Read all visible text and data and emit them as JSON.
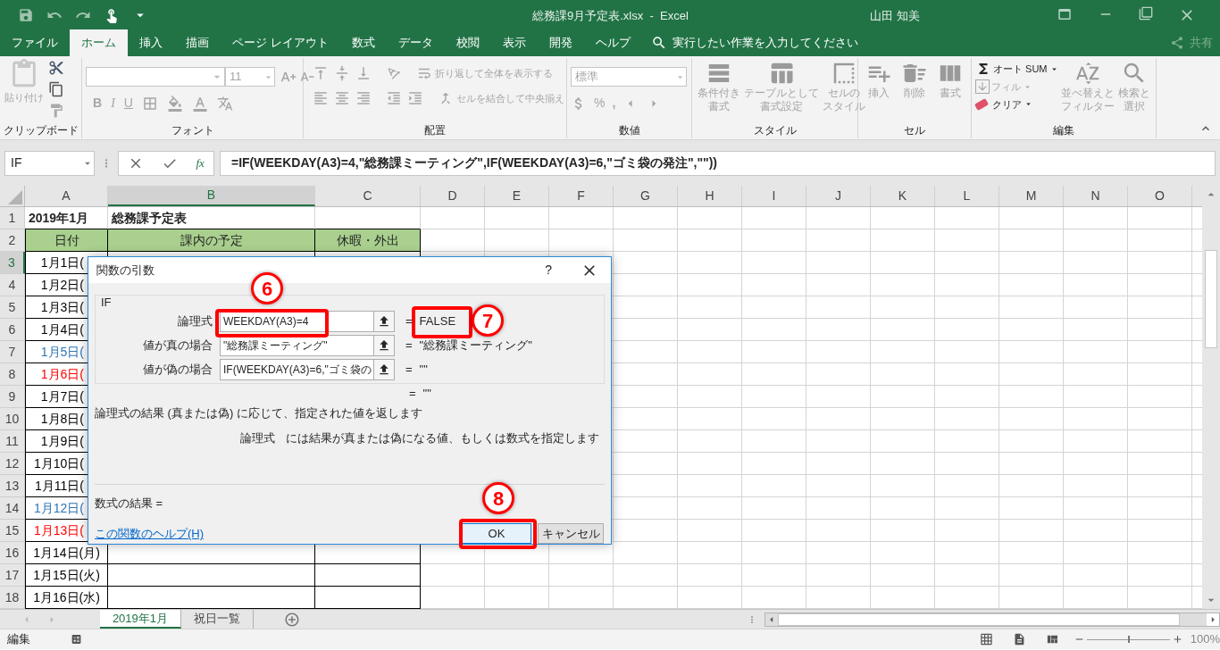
{
  "title_bar": {
    "title": "総務課9月予定表.xlsx  -  Excel",
    "user": "山田 知美"
  },
  "menu_tabs": [
    {
      "label": "ファイル",
      "selected": false
    },
    {
      "label": "ホーム",
      "selected": true
    },
    {
      "label": "挿入",
      "selected": false
    },
    {
      "label": "描画",
      "selected": false
    },
    {
      "label": "ページ レイアウト",
      "selected": false
    },
    {
      "label": "数式",
      "selected": false
    },
    {
      "label": "データ",
      "selected": false
    },
    {
      "label": "校閲",
      "selected": false
    },
    {
      "label": "表示",
      "selected": false
    },
    {
      "label": "開発",
      "selected": false
    },
    {
      "label": "ヘルプ",
      "selected": false
    }
  ],
  "tell_me": {
    "placeholder": "実行したい作業を入力してください"
  },
  "share": "共有",
  "ribbon": {
    "clipboard": {
      "label": "クリップボード",
      "paste": {
        "label": "貼り付け",
        "disabled": true
      }
    },
    "font": {
      "label": "フォント",
      "size": "11",
      "bold": "B",
      "italic": "I",
      "underline": "U"
    },
    "alignment": {
      "label": "配置",
      "wrap": {
        "label": "折り返して全体を表示する",
        "disabled": true
      },
      "merge": {
        "label": "セルを結合して中央揃え",
        "disabled": true
      }
    },
    "number": {
      "label": "数値",
      "format": "標準",
      "percent": "%",
      "comma": ","
    },
    "styles": {
      "label": "スタイル",
      "commands": [
        {
          "lines": [
            "条件付き",
            "書式"
          ],
          "disabled": true
        },
        {
          "lines": [
            "テーブルとして",
            "書式設定"
          ],
          "disabled": true
        },
        {
          "lines": [
            "セルの",
            "スタイル"
          ],
          "disabled": true
        }
      ]
    },
    "cells": {
      "label": "セル",
      "commands": [
        {
          "lines": [
            "挿入"
          ],
          "disabled": true
        },
        {
          "lines": [
            "削除"
          ],
          "disabled": true
        },
        {
          "lines": [
            "書式"
          ],
          "disabled": true
        }
      ]
    },
    "editing": {
      "label": "編集",
      "autosum": {
        "label": "オート SUM",
        "disabled": false
      },
      "fill": {
        "label": "フィル",
        "disabled": true
      },
      "clear": {
        "label": "クリア",
        "disabled": false
      },
      "commands": [
        {
          "lines": [
            "並べ替えと",
            "フィルター"
          ],
          "disabled": true
        },
        {
          "lines": [
            "検索と",
            "選択"
          ],
          "disabled": true
        }
      ]
    }
  },
  "formula_bar": {
    "name_box": "IF",
    "function_button": "fx",
    "formula": "=IF(WEEKDAY(A3)=4,\"総務課ミーティング\",IF(WEEKDAY(A3)=6,\"ゴミ袋の発注\",\"\"))"
  },
  "columns": [
    {
      "label": "A",
      "selected": false
    },
    {
      "label": "B",
      "selected": true
    },
    {
      "label": "C",
      "selected": false
    },
    {
      "label": "D",
      "selected": false
    },
    {
      "label": "E",
      "selected": false
    },
    {
      "label": "F",
      "selected": false
    },
    {
      "label": "G",
      "selected": false
    },
    {
      "label": "H",
      "selected": false
    },
    {
      "label": "I",
      "selected": false
    },
    {
      "label": "J",
      "selected": false
    },
    {
      "label": "K",
      "selected": false
    },
    {
      "label": "L",
      "selected": false
    },
    {
      "label": "M",
      "selected": false
    },
    {
      "label": "N",
      "selected": false
    },
    {
      "label": "O",
      "selected": false
    }
  ],
  "rows": [
    {
      "number": "1",
      "selected": false,
      "kind": "title",
      "cells": [
        "2019年1月",
        "総務課予定表"
      ]
    },
    {
      "number": "2",
      "selected": false,
      "kind": "header",
      "cells": [
        "日付",
        "課内の予定",
        "休暇・外出"
      ]
    },
    {
      "number": "3",
      "selected": true,
      "kind": "date",
      "date": "1月1日(",
      "color": "#000000",
      "covered": true
    },
    {
      "number": "4",
      "selected": false,
      "kind": "date",
      "date": "1月2日(",
      "color": "#000000",
      "covered": true
    },
    {
      "number": "5",
      "selected": false,
      "kind": "date",
      "date": "1月3日(",
      "color": "#000000",
      "covered": true
    },
    {
      "number": "6",
      "selected": false,
      "kind": "date",
      "date": "1月4日(",
      "color": "#000000",
      "covered": true
    },
    {
      "number": "7",
      "selected": false,
      "kind": "date",
      "date": "1月5日(",
      "color": "#2f75b5",
      "covered": true
    },
    {
      "number": "8",
      "selected": false,
      "kind": "date",
      "date": "1月6日(",
      "color": "#ff0000",
      "covered": true
    },
    {
      "number": "9",
      "selected": false,
      "kind": "date",
      "date": "1月7日(",
      "color": "#000000",
      "covered": true
    },
    {
      "number": "10",
      "selected": false,
      "kind": "date",
      "date": "1月8日(",
      "color": "#000000",
      "covered": true
    },
    {
      "number": "11",
      "selected": false,
      "kind": "date",
      "date": "1月9日(",
      "color": "#000000",
      "covered": true
    },
    {
      "number": "12",
      "selected": false,
      "kind": "date",
      "date": "1月10日(",
      "color": "#000000",
      "covered": true
    },
    {
      "number": "13",
      "selected": false,
      "kind": "date",
      "date": "1月11日(",
      "color": "#000000",
      "covered": true
    },
    {
      "number": "14",
      "selected": false,
      "kind": "date",
      "date": "1月12日(",
      "color": "#2f75b5",
      "covered": true
    },
    {
      "number": "15",
      "selected": false,
      "kind": "date",
      "date": "1月13日(",
      "color": "#ff0000",
      "covered": true
    },
    {
      "number": "16",
      "selected": false,
      "kind": "date",
      "date": "1月14日(月)",
      "color": "#000000",
      "covered": false
    },
    {
      "number": "17",
      "selected": false,
      "kind": "date",
      "date": "1月15日(火)",
      "color": "#000000",
      "covered": false
    },
    {
      "number": "18",
      "selected": false,
      "kind": "date",
      "date": "1月16日(水)",
      "color": "#000000",
      "covered": false
    }
  ],
  "dialog": {
    "title": "関数の引数",
    "help": "?",
    "function": "IF",
    "arguments": [
      {
        "label": "論理式",
        "value": "WEEKDAY(A3)=4",
        "equals": "=",
        "result": "FALSE"
      },
      {
        "label": "値が真の場合",
        "value": "\"総務課ミーティング\"",
        "equals": "=",
        "result": "\"総務課ミーティング\""
      },
      {
        "label": "値が偽の場合",
        "value": "IF(WEEKDAY(A3)=6,\"ゴミ袋の",
        "equals": "=",
        "result": "\"\""
      }
    ],
    "overall": {
      "equals": "=",
      "result": "\"\""
    },
    "description": "論理式の結果 (真または偽) に応じて、指定された値を返します",
    "argument_help": {
      "name": "論理式",
      "text": "には結果が真または偽になる値、もしくは数式を指定します"
    },
    "formula_result": "数式の結果 =",
    "help_link": "この関数のヘルプ(H)",
    "buttons": [
      {
        "label": "OK",
        "default": true
      },
      {
        "label": "キャンセル",
        "default": false
      }
    ]
  },
  "annotations": [
    {
      "number": "6"
    },
    {
      "number": "7"
    },
    {
      "number": "8"
    }
  ],
  "sheet_tabs": [
    {
      "label": "2019年1月",
      "selected": true
    },
    {
      "label": "祝日一覧",
      "selected": false
    }
  ],
  "status_bar": {
    "mode": "編集",
    "zoom": {
      "level": 0.5,
      "label": "100%"
    }
  }
}
